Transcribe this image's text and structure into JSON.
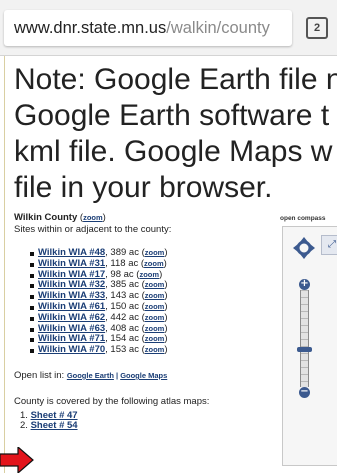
{
  "browser": {
    "url_host": "www.dnr.state.mn.us",
    "url_path": "/walkin/county",
    "tab_count": "2"
  },
  "page": {
    "note_lines": [
      "Note: Google Earth file n",
      "Google Earth software t",
      "kml file. Google Maps w",
      "file in your browser."
    ],
    "county_title": "Wilkin County",
    "county_paren_open": " (",
    "county_zoom": "zoom",
    "county_paren_close": ")",
    "subtitle": "Sites within or adjacent to the county:",
    "sites": [
      {
        "name": "Wilkin WIA #48",
        "acres": ", 389 ac (",
        "zoom": "zoom",
        "close": ")"
      },
      {
        "name": "Wilkin WIA #31",
        "acres": ", 118 ac (",
        "zoom": "zoom",
        "close": ")"
      },
      {
        "name": "Wilkin WIA #17",
        "acres": ", 98 ac (",
        "zoom": "zoom",
        "close": ")"
      },
      {
        "name": "Wilkin WIA #32",
        "acres": ", 385 ac (",
        "zoom": "zoom",
        "close": ")"
      },
      {
        "name": "Wilkin WIA #33",
        "acres": ", 143 ac (",
        "zoom": "zoom",
        "close": ")"
      },
      {
        "name": "Wilkin WIA #61",
        "acres": ", 150 ac (",
        "zoom": "zoom",
        "close": ")"
      },
      {
        "name": "Wilkin WIA #62",
        "acres": ", 442 ac (",
        "zoom": "zoom",
        "close": ")"
      },
      {
        "name": "Wilkin WIA #63",
        "acres": ", 408 ac (",
        "zoom": "zoom",
        "close": ")"
      },
      {
        "name": "Wilkin WIA #71",
        "acres": ", 154 ac (",
        "zoom": "zoom",
        "close": ")"
      },
      {
        "name": "Wilkin WIA #70",
        "acres": ", 153 ac (",
        "zoom": "zoom",
        "close": ")"
      }
    ],
    "open_list_label": "Open list in: ",
    "google_earth_link": "Google Earth",
    "separator": " | ",
    "google_maps_link": "Google Maps",
    "covered_text": "County is covered by the following atlas maps:",
    "sheets": [
      {
        "num": "1. ",
        "label": "Sheet # 47"
      },
      {
        "num": "2. ",
        "label": "Sheet # 54"
      }
    ],
    "map_label": "open compass"
  },
  "colors": {
    "link": "#1a3d75",
    "arrow": "#e3141b",
    "map_control": "#3c5a8f"
  }
}
